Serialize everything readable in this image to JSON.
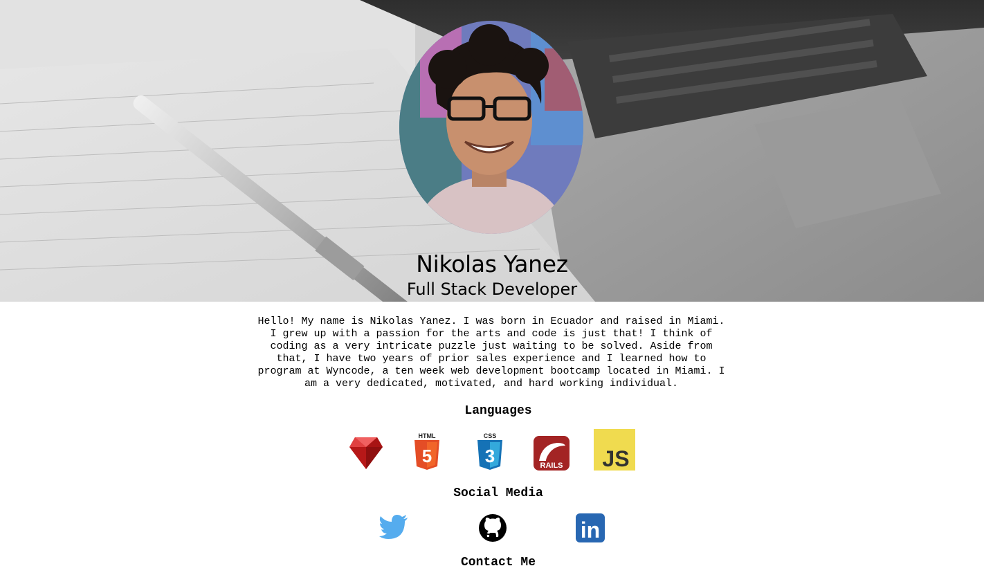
{
  "profile": {
    "name": "Nikolas Yanez",
    "title": "Full Stack Developer",
    "bio_lines": [
      "Hello! My name is Nikolas Yanez. I was born in Ecuador and raised in Miami.",
      "I grew up with a passion for the arts and code is just that! I think of",
      "coding as a very intricate puzzle just waiting to be solved. Aside from",
      "that, I have two years of prior sales experience and I learned how to",
      "program at Wyncode, a ten week web development bootcamp located in Miami. I",
      "am a very dedicated, motivated, and hard working individual."
    ]
  },
  "sections": {
    "languages": "Languages",
    "social_media": "Social Media",
    "contact": "Contact Me"
  },
  "languages": [
    {
      "icon": "ruby-icon"
    },
    {
      "icon": "html5-icon",
      "label": "HTML",
      "badge": "5"
    },
    {
      "icon": "css3-icon",
      "label": "CSS",
      "badge": "3"
    },
    {
      "icon": "rails-icon",
      "label": "RAILS"
    },
    {
      "icon": "javascript-icon",
      "label": "JS"
    }
  ],
  "social": [
    {
      "icon": "twitter-icon",
      "color": "#55acee"
    },
    {
      "icon": "github-icon",
      "color": "#000000"
    },
    {
      "icon": "linkedin-icon",
      "label": "in",
      "color": "#2867b2"
    }
  ]
}
